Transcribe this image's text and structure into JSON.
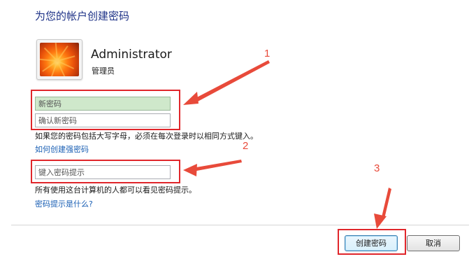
{
  "dialog": {
    "heading": "为您的帐户创建密码",
    "user": {
      "name": "Administrator",
      "role": "管理员"
    }
  },
  "form": {
    "new_password_placeholder": "新密码",
    "confirm_password_placeholder": "确认新密码",
    "case_sensitivity_note": "如果您的密码包括大写字母，必须在每次登录时以相同方式键入。",
    "strong_password_link": "如何创建强密码",
    "hint_placeholder": "键入密码提示",
    "hint_visibility_note": "所有使用这台计算机的人都可以看见密码提示。",
    "hint_help_link": "密码提示是什么?"
  },
  "buttons": {
    "create": "创建密码",
    "cancel": "取消"
  },
  "annotations": {
    "labels": [
      "1",
      "2",
      "3"
    ],
    "color": "#e0262b"
  },
  "colors": {
    "heading": "#1e3287",
    "link": "#1a5fb4",
    "focused_field": "#cfe8cb"
  }
}
